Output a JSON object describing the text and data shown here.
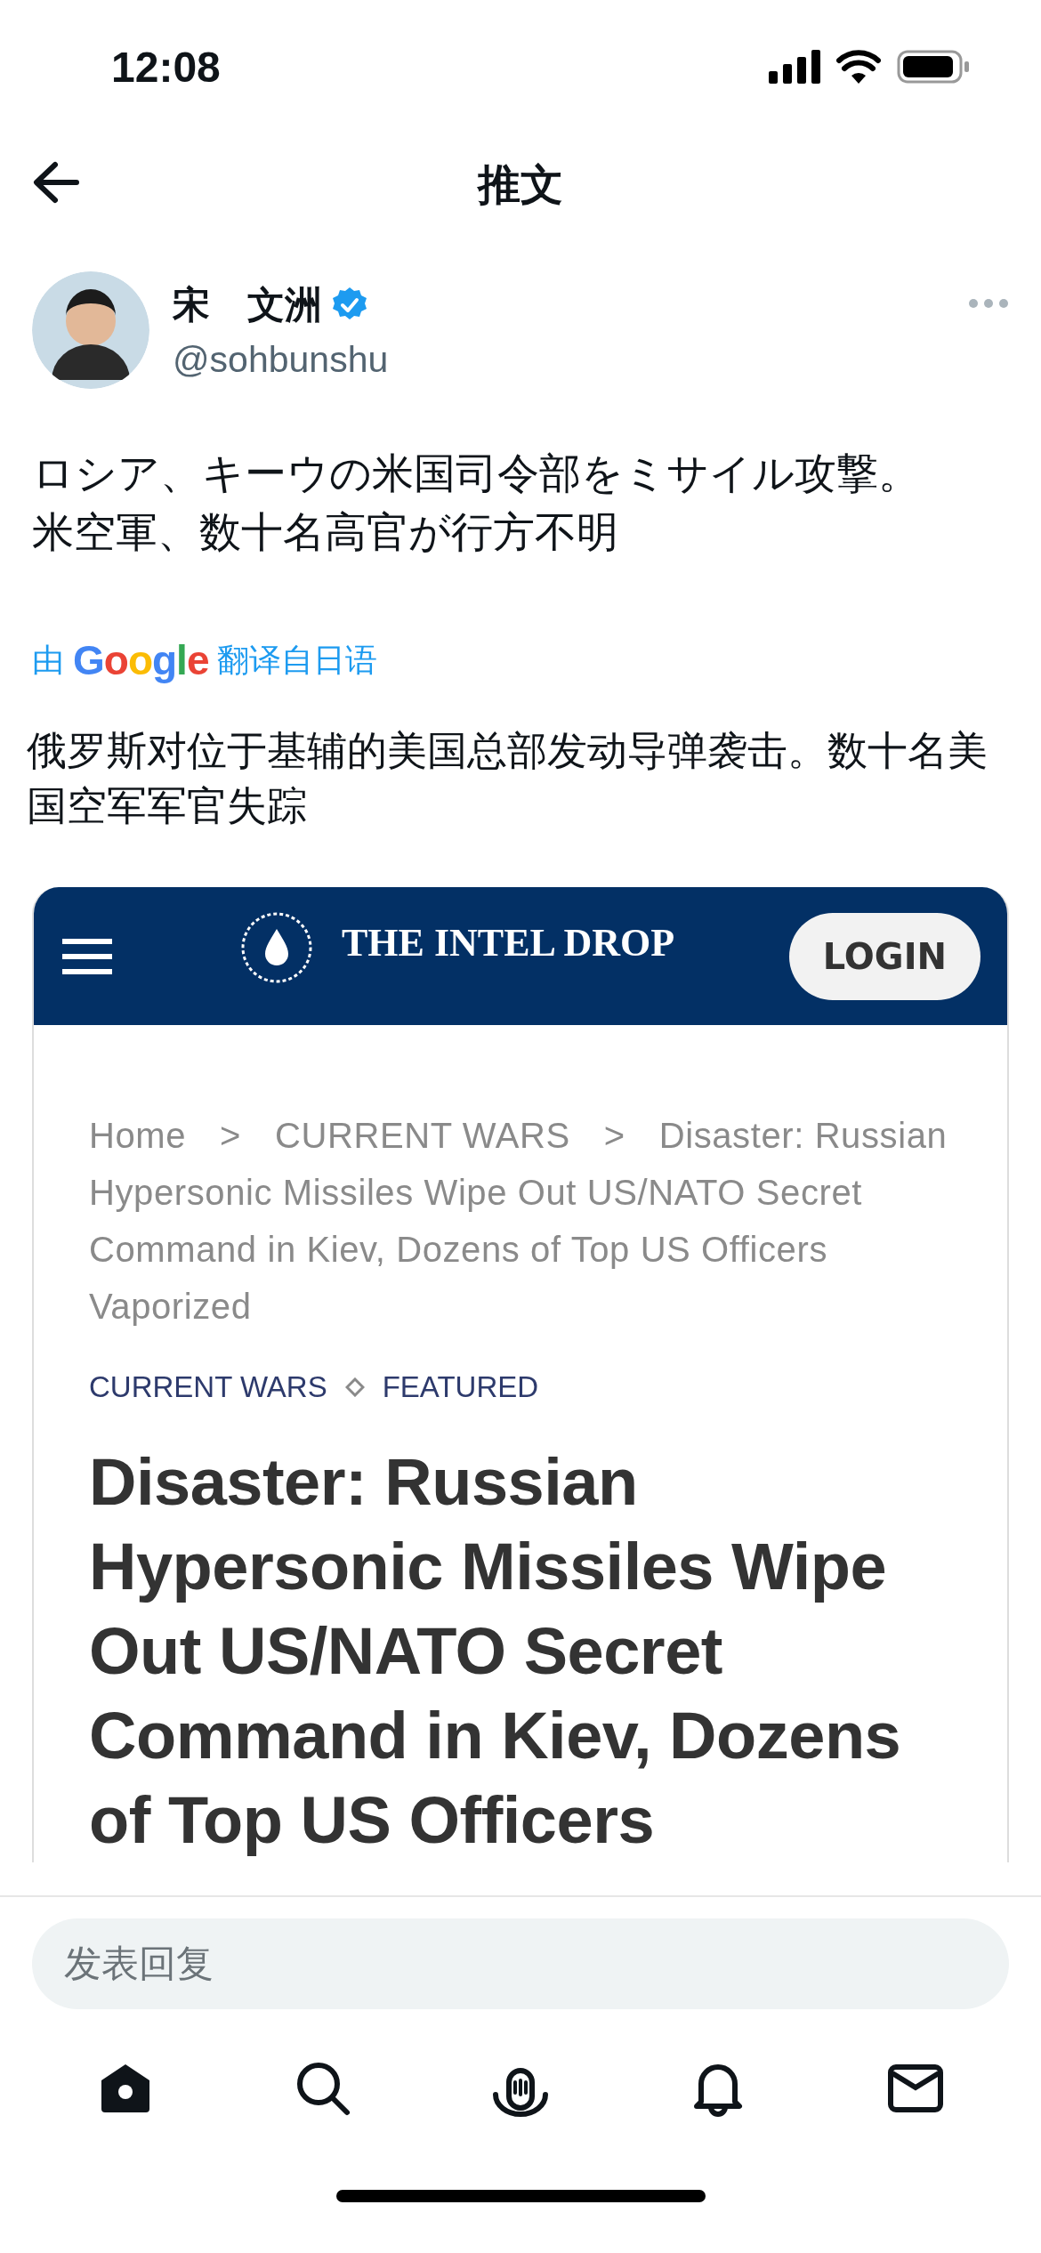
{
  "status_bar": {
    "time": "12:08"
  },
  "header": {
    "title": "推文"
  },
  "tweet": {
    "author": {
      "name": "宋　文洲",
      "handle": "@sohbunshu",
      "verified": true
    },
    "text": "ロシア、キーウの米国司令部をミサイル攻撃。米空軍、数十名高官が行方不明",
    "translation_credit": {
      "prefix": "由",
      "brand": "Google",
      "suffix": "翻译自日语"
    },
    "translation": "俄罗斯对位于基辅的美国总部发动导弹袭击。数十名美国空军军官失踪"
  },
  "embedded_page": {
    "site_title": "THE INTEL DROP",
    "login": "LOGIN",
    "breadcrumb_separator": ">",
    "breadcrumb": [
      "Home",
      "CURRENT WARS",
      "Disaster: Russian Hypersonic Missiles Wipe Out US/NATO Secret Command in Kiev, Dozens of Top US Officers Vaporized"
    ],
    "categories": [
      "CURRENT WARS",
      "FEATURED"
    ],
    "headline": "Disaster: Russian Hypersonic Missiles Wipe Out US/NATO Secret Command in Kiev, Dozens of Top US Officers"
  },
  "reply": {
    "placeholder": "发表回复"
  },
  "nav": [
    {
      "kind": "home",
      "selected": true
    },
    {
      "kind": "search",
      "selected": false
    },
    {
      "kind": "spaces",
      "selected": false
    },
    {
      "kind": "notifications",
      "selected": false
    },
    {
      "kind": "messages",
      "selected": false
    }
  ]
}
